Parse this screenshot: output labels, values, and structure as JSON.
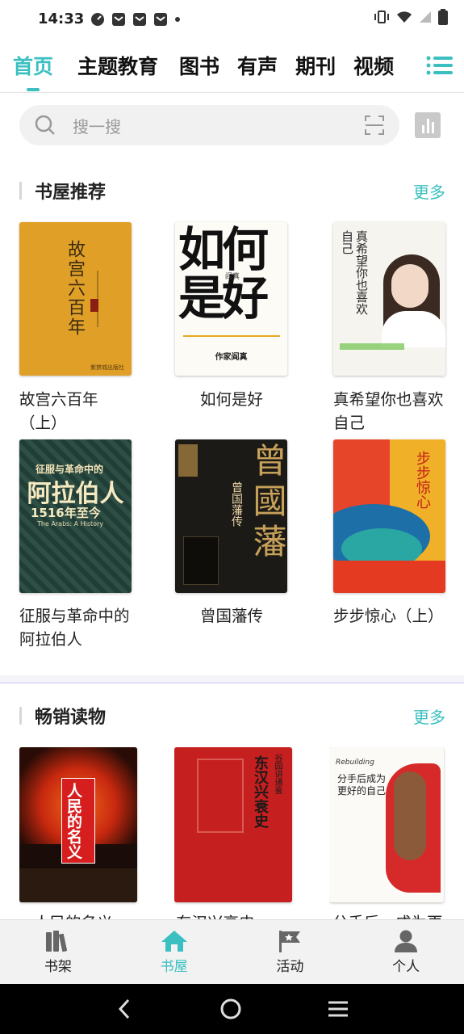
{
  "status": {
    "time": "14:33"
  },
  "tabs": [
    "首页",
    "主题教育",
    "图书",
    "有声",
    "期刊",
    "视频"
  ],
  "search": {
    "placeholder": "搜一搜"
  },
  "sections": [
    {
      "title": "书屋推荐",
      "more": "更多",
      "books": [
        {
          "title": "故宫六百年（上）",
          "cover_text": "故宫六百年"
        },
        {
          "title": "如何是好",
          "cover_text_1": "如何",
          "cover_text_2": "是好",
          "cover_sub": "阎真",
          "cover_note": "作家阎真"
        },
        {
          "title": "真希望你也喜欢自己",
          "cover_text": "真希望你也喜欢自己"
        },
        {
          "title": "征服与革命中的阿拉伯人",
          "cover_text_1": "征服与革命中的",
          "cover_text_2": "阿拉伯人",
          "cover_text_3": "1516年至今",
          "cover_text_4": "The Arabs: A History"
        },
        {
          "title": "曾国藩传",
          "cover_text": "曾國藩",
          "cover_sub": "曾国藩传"
        },
        {
          "title": "步步惊心（上）",
          "cover_text": "步步惊心"
        }
      ]
    },
    {
      "title": "畅销读物",
      "more": "更多",
      "books": [
        {
          "title": "人民的名义",
          "cover_text": "人民的名义"
        },
        {
          "title": "东汉兴衰史",
          "cover_text": "东汉兴衰史",
          "cover_sub": "谷园讲通鉴"
        },
        {
          "title": "分手后，成为更好的自己",
          "cover_text": "分手后成为更好的自己",
          "cover_sub": "Rebuilding"
        }
      ]
    }
  ],
  "bottom_nav": [
    {
      "label": "书架",
      "icon": "bookshelf-icon"
    },
    {
      "label": "书屋",
      "icon": "house-icon"
    },
    {
      "label": "活动",
      "icon": "flag-icon"
    },
    {
      "label": "个人",
      "icon": "person-icon"
    }
  ],
  "colors": {
    "accent": "#3bbfc0"
  }
}
